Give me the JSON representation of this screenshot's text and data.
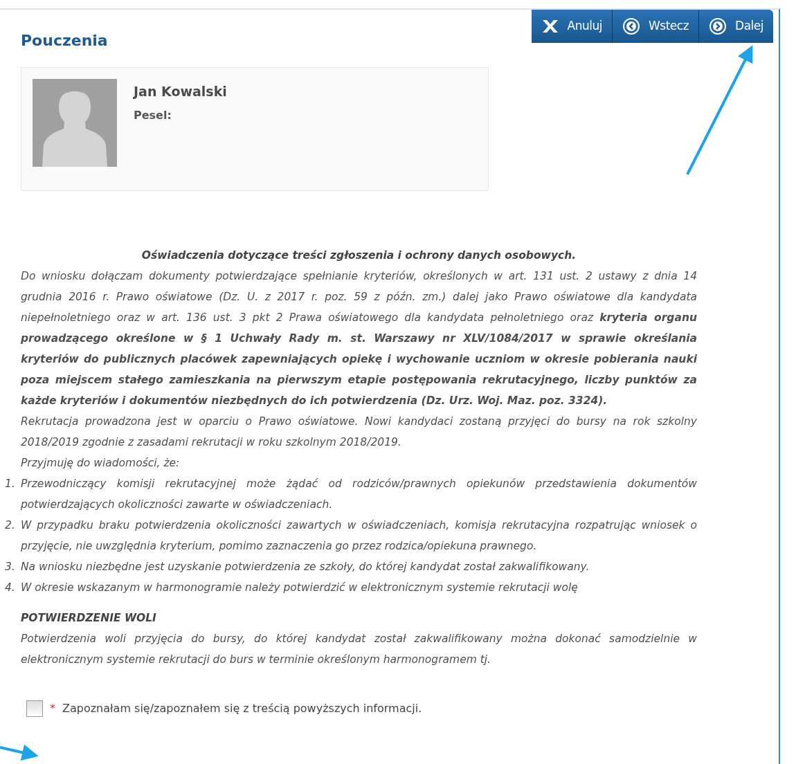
{
  "page_title": "Pouczenia",
  "toolbar": [
    {
      "kind": "cancel",
      "label": "Anuluj"
    },
    {
      "kind": "back",
      "label": "Wstecz"
    },
    {
      "kind": "next",
      "label": "Dalej"
    }
  ],
  "profile": {
    "name": "Jan Kowalski",
    "pesel_label": "Pesel:"
  },
  "statement": {
    "heading": "Oświadczenia dotyczące treści zgłoszenia i ochrony danych osobowych.",
    "paragraphs": [
      "Do wniosku dołączam dokumenty potwierdzające spełnianie kryteriów, określonych w art. 131 ust. 2 ustawy z dnia 14 grudnia 2016 r. Prawo oświatowe (Dz. U. z 2017 r. poz. 59 z późn. zm.) dalej jako Prawo oświatowe dla kandydata niepełnoletniego oraz w art. 136 ust. 3 pkt 2 Prawa oświatowego dla kandydata pełnoletniego oraz **kryteria organu prowadzącego określone w § 1 Uchwały Rady m. st. Warszawy nr XLV/1084/2017 w sprawie określania kryteriów do publicznych placówek zapewniających opiekę i wychowanie uczniom w okresie pobierania nauki poza miejscem stałego zamieszkania na pierwszym etapie postępowania rekrutacyjnego, liczby punktów za każde  kryteriów i dokumentów niezbędnych do ich potwierdzenia (Dz. Urz. Woj. Maz. poz. 3324).**",
      "Rekrutacja prowadzona jest w oparciu o Prawo oświatowe. Nowi kandydaci zostaną przyjęci do bursy na rok szkolny 2018/2019 zgodnie z zasadami rekrutacji w roku szkolnym 2018/2019.",
      "Przyjmuję do wiadomości, że:"
    ],
    "items": [
      {
        "number": "1.",
        "text": "Przewodniczący komisji rekrutacyjnej może żądać od rodziców/prawnych opiekunów przedstawienia dokumentów potwierdzających okoliczności zawarte w oświadczeniach."
      },
      {
        "number": "2.",
        "text": "W przypadku braku potwierdzenia okoliczności zawartych w oświadczeniach, komisja rekrutacyjna rozpatrując wniosek o przyjęcie, nie uwzględnia kryterium, pomimo zaznaczenia go przez rodzica/opiekuna prawnego."
      },
      {
        "number": "3.",
        "text": "Na wniosku niezbędne jest uzyskanie potwierdzenia ze szkoły, do której kandydat został zakwalifikowany."
      },
      {
        "number": "4.",
        "text": "W okresie wskazanym w harmonogramie należy potwierdzić w elektronicznym systemie rekrutacji wolę"
      }
    ],
    "subheading": "POTWIERDZENIE WOLI",
    "subtext": "Potwierdzenia woli przyjęcia do bursy, do której kandydat został zakwalifikowany można dokonać samodzielnie w elektronicznym systemie rekrutacji do burs w terminie określonym harmonogramem tj."
  },
  "consent": {
    "required_mark": "*",
    "label": "Zapoznałam się/zapoznałem się z treścią powyższych informacji.",
    "checked": false
  }
}
